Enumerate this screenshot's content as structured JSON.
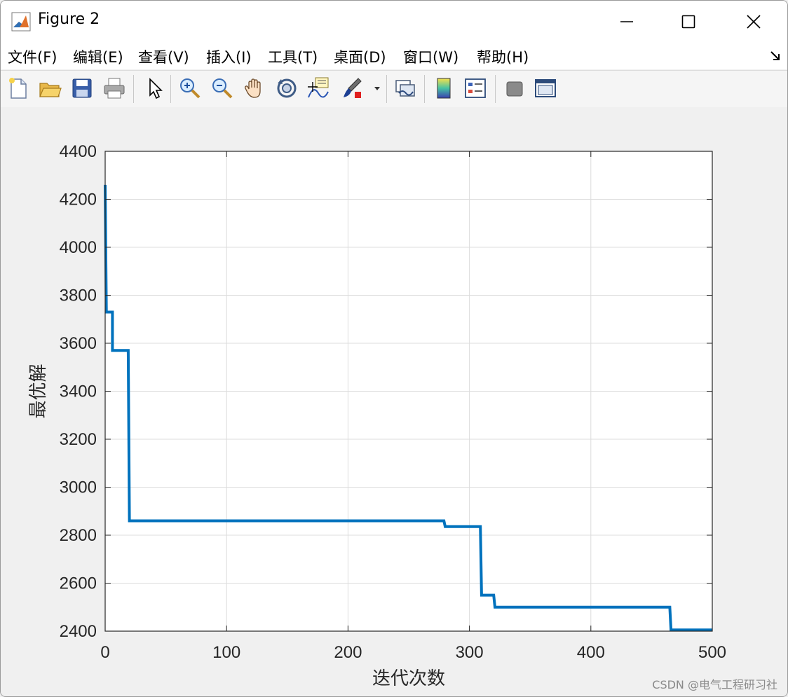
{
  "window": {
    "title": "Figure 2",
    "controls": [
      "minimize-icon",
      "maximize-icon",
      "close-icon"
    ]
  },
  "menu": [
    {
      "label": "文件(F)"
    },
    {
      "label": "编辑(E)"
    },
    {
      "label": "查看(V)"
    },
    {
      "label": "插入(I)"
    },
    {
      "label": "工具(T)"
    },
    {
      "label": "桌面(D)"
    },
    {
      "label": "窗口(W)"
    },
    {
      "label": "帮助(H)"
    }
  ],
  "toolbar": {
    "icons": [
      "new-figure-icon",
      "open-file-icon",
      "save-icon",
      "print-icon",
      "edit-plot-arrow-icon",
      "zoom-in-icon",
      "zoom-out-icon",
      "pan-hand-icon",
      "rotate-3d-icon",
      "data-cursor-icon",
      "brush-icon",
      "brush-dropdown-icon",
      "link-plot-icon",
      "colorbar-icon",
      "legend-icon",
      "hide-plot-tools-icon",
      "show-plot-tools-icon"
    ]
  },
  "colors": {
    "line": "#0072BD",
    "axes_bg": "#ffffff",
    "figure_bg": "#f0f0f0",
    "grid": "#dcdcdc"
  },
  "chart_data": {
    "type": "line",
    "title": "",
    "xlabel": "迭代次数",
    "ylabel": "最优解",
    "xlim": [
      0,
      500
    ],
    "ylim": [
      2400,
      4400
    ],
    "xticks": [
      0,
      100,
      200,
      300,
      400,
      500
    ],
    "yticks": [
      2400,
      2600,
      2800,
      3000,
      3200,
      3400,
      3600,
      3800,
      4000,
      4200,
      4400
    ],
    "grid": true,
    "series": [
      {
        "color": "#0072BD",
        "x": [
          0,
          1,
          1,
          6,
          6,
          19,
          19,
          20,
          20,
          279,
          280,
          280,
          309,
          309,
          310,
          310,
          320,
          321,
          321,
          465,
          466,
          466,
          500
        ],
        "y": [
          4260,
          3730,
          3730,
          3730,
          3570,
          3570,
          3570,
          2860,
          2860,
          2860,
          2836,
          2836,
          2836,
          2836,
          2550,
          2550,
          2550,
          2500,
          2500,
          2500,
          2405,
          2405,
          2405
        ]
      }
    ]
  },
  "watermark": "CSDN @电气工程研习社"
}
